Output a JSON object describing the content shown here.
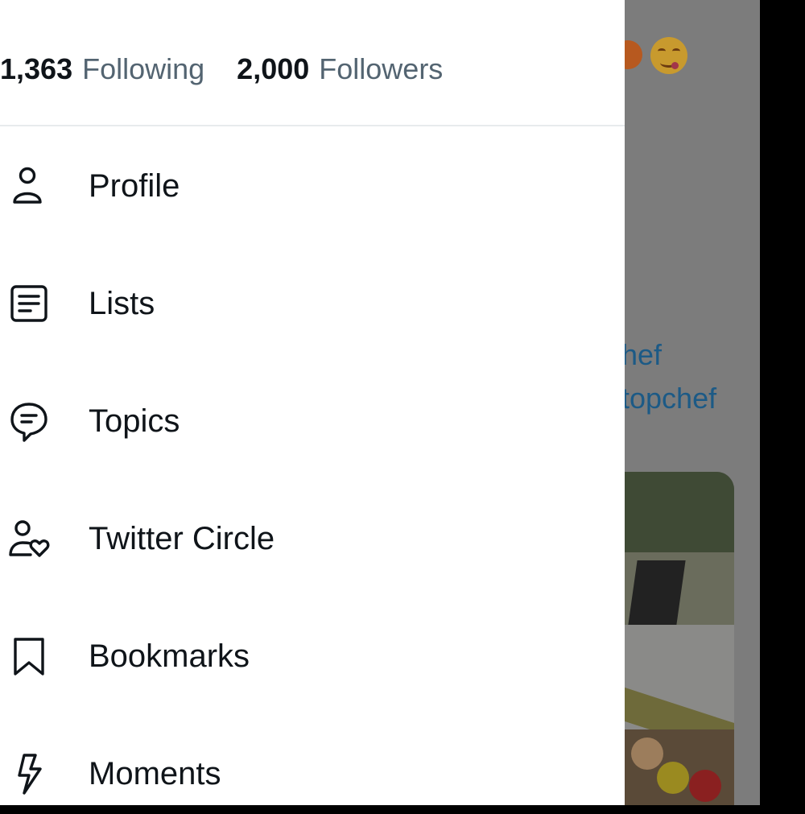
{
  "stats": {
    "following_count": "1,363",
    "following_label": "Following",
    "followers_count": "2,000",
    "followers_label": "Followers"
  },
  "menu": [
    {
      "label": "Profile",
      "icon": "person-icon"
    },
    {
      "label": "Lists",
      "icon": "list-icon"
    },
    {
      "label": "Topics",
      "icon": "topic-bubble-icon"
    },
    {
      "label": "Twitter Circle",
      "icon": "person-heart-icon"
    },
    {
      "label": "Bookmarks",
      "icon": "bookmark-icon"
    },
    {
      "label": "Moments",
      "icon": "lightning-icon"
    }
  ],
  "background_feed": {
    "text_fragment_1": "hef",
    "text_fragment_2": "topchef"
  },
  "colors": {
    "primary_text": "#0f1419",
    "secondary_text": "#536471",
    "divider": "#e7ebed",
    "overlay": "#7c7c7c"
  }
}
